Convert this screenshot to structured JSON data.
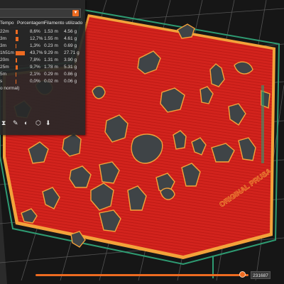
{
  "stats": {
    "headers": {
      "time": "Tempo",
      "percentage": "Porcentagem",
      "filament": "Filamento utilizado"
    },
    "rows": [
      {
        "time": "22m",
        "percent": "8,6%",
        "percent_value": 8.6,
        "length": "1.53 m",
        "weight": "4.56 g"
      },
      {
        "time": "3m",
        "percent": "12,7%",
        "percent_value": 12.7,
        "length": "1.55 m",
        "weight": "4.61 g"
      },
      {
        "time": "3m",
        "percent": "1,3%",
        "percent_value": 1.3,
        "length": "0.23 m",
        "weight": "0.69 g"
      },
      {
        "time": "1h51m",
        "percent": "43,7%",
        "percent_value": 43.7,
        "length": "9.29 m",
        "weight": "27.71 g"
      },
      {
        "time": "20m",
        "percent": "7,8%",
        "percent_value": 7.8,
        "length": "1.31 m",
        "weight": "3.90 g"
      },
      {
        "time": "25m",
        "percent": "9,7%",
        "percent_value": 9.7,
        "length": "1.78 m",
        "weight": "5.31 g"
      },
      {
        "time": "5m",
        "percent": "2,1%",
        "percent_value": 2.1,
        "length": "0.29 m",
        "weight": "0.86 g"
      },
      {
        "time": "s",
        "percent": "0,0%",
        "percent_value": 0.0,
        "length": "0.02 m",
        "weight": "0.06 g"
      }
    ],
    "mode_note": "o normal)"
  },
  "bed": {
    "label": "ORIGINAL PRUSA"
  },
  "slider": {
    "layer_value": "231687",
    "position_fraction": 0.97
  },
  "colors": {
    "accent": "#ed6b21",
    "perimeter": "#f3a23a",
    "infill": "#d3231d",
    "void": "#3f4447",
    "bed": "#1a1a1a",
    "grid": "#8a8a8a",
    "skirt": "#2e9b72"
  },
  "icons": {
    "toolbar": [
      "hourglass-icon",
      "pen-icon",
      "color-icon",
      "cube-icon",
      "download-icon"
    ]
  }
}
